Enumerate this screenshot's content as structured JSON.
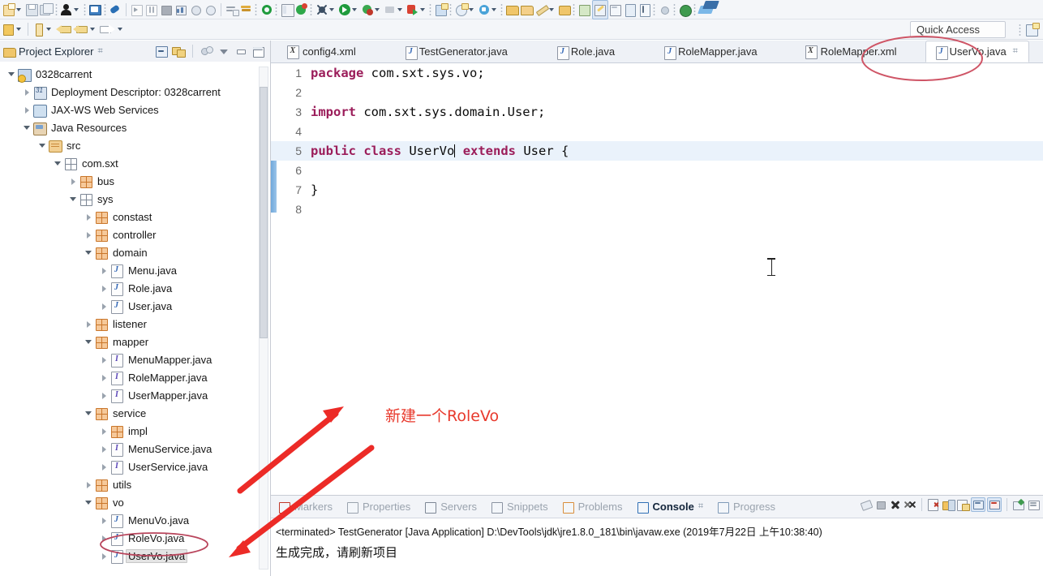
{
  "app": {
    "quick_access_label": "Quick Access"
  },
  "toolbar": {
    "row1_icons": [
      "new-wizard-icon",
      "save-icon",
      "save-all-icon",
      "user-account-icon",
      "print-icon",
      "link-icon",
      "run-last-icon",
      "debug-step-icon",
      "terminate-icon",
      "profile-icon",
      "coverage-icon",
      "run-ant-icon",
      "search-icon",
      "open-type-icon",
      "refresh-icon",
      "validate-icon",
      "new-java-project-icon",
      "run-icon",
      "debug-icon",
      "external-tools-icon",
      "server-icon",
      "new-class-icon",
      "new-package-icon",
      "open-task-icon",
      "git-icon",
      "database-icon",
      "report-icon",
      "maven-icon",
      "pin-icon"
    ],
    "row2_icons": [
      "new-wizard-icon",
      "new-annotation-icon",
      "back-icon",
      "forward-icon",
      "next-icon"
    ]
  },
  "explorer": {
    "title": "Project Explorer",
    "close_glyph": "⌗",
    "toolbar_icons": [
      "collapse-all-icon",
      "link-with-editor-icon",
      "view-filter-icon",
      "view-menu-icon",
      "minimize-icon",
      "maximize-icon"
    ],
    "tree": [
      {
        "label": "0328carrent",
        "depth": 0,
        "icon": "project-icon",
        "arrow": "expanded",
        "selected": false
      },
      {
        "label": "Deployment Descriptor: 0328carrent",
        "depth": 1,
        "icon": "deployment-icon",
        "arrow": "collapsed",
        "selected": false
      },
      {
        "label": "JAX-WS Web Services",
        "depth": 1,
        "icon": "web-services-icon",
        "arrow": "collapsed",
        "selected": false
      },
      {
        "label": "Java Resources",
        "depth": 1,
        "icon": "java-resources-icon",
        "arrow": "expanded",
        "selected": false
      },
      {
        "label": "src",
        "depth": 2,
        "icon": "source-folder-icon",
        "arrow": "expanded",
        "selected": false
      },
      {
        "label": "com.sxt",
        "depth": 3,
        "icon": "package-grey-icon",
        "arrow": "expanded",
        "selected": false
      },
      {
        "label": "bus",
        "depth": 4,
        "icon": "package-icon",
        "arrow": "collapsed",
        "selected": false
      },
      {
        "label": "sys",
        "depth": 4,
        "icon": "package-grey-icon",
        "arrow": "expanded",
        "selected": false
      },
      {
        "label": "constast",
        "depth": 5,
        "icon": "package-icon",
        "arrow": "collapsed",
        "selected": false
      },
      {
        "label": "controller",
        "depth": 5,
        "icon": "package-icon",
        "arrow": "collapsed",
        "selected": false
      },
      {
        "label": "domain",
        "depth": 5,
        "icon": "package-icon",
        "arrow": "expanded",
        "selected": false
      },
      {
        "label": "Menu.java",
        "depth": 6,
        "icon": "java-class-icon",
        "arrow": "collapsed",
        "selected": false
      },
      {
        "label": "Role.java",
        "depth": 6,
        "icon": "java-class-icon",
        "arrow": "collapsed",
        "selected": false
      },
      {
        "label": "User.java",
        "depth": 6,
        "icon": "java-class-icon",
        "arrow": "collapsed",
        "selected": false
      },
      {
        "label": "listener",
        "depth": 5,
        "icon": "package-icon",
        "arrow": "collapsed",
        "selected": false
      },
      {
        "label": "mapper",
        "depth": 5,
        "icon": "package-icon",
        "arrow": "expanded",
        "selected": false
      },
      {
        "label": "MenuMapper.java",
        "depth": 6,
        "icon": "java-interface-icon",
        "arrow": "collapsed",
        "selected": false
      },
      {
        "label": "RoleMapper.java",
        "depth": 6,
        "icon": "java-interface-icon",
        "arrow": "collapsed",
        "selected": false
      },
      {
        "label": "UserMapper.java",
        "depth": 6,
        "icon": "java-interface-icon",
        "arrow": "collapsed",
        "selected": false
      },
      {
        "label": "service",
        "depth": 5,
        "icon": "package-icon",
        "arrow": "expanded",
        "selected": false
      },
      {
        "label": "impl",
        "depth": 6,
        "icon": "package-icon",
        "arrow": "collapsed",
        "selected": false
      },
      {
        "label": "MenuService.java",
        "depth": 6,
        "icon": "java-interface-icon",
        "arrow": "collapsed",
        "selected": false
      },
      {
        "label": "UserService.java",
        "depth": 6,
        "icon": "java-interface-icon",
        "arrow": "collapsed",
        "selected": false
      },
      {
        "label": "utils",
        "depth": 5,
        "icon": "package-icon",
        "arrow": "collapsed",
        "selected": false
      },
      {
        "label": "vo",
        "depth": 5,
        "icon": "package-icon",
        "arrow": "expanded",
        "selected": false
      },
      {
        "label": "MenuVo.java",
        "depth": 6,
        "icon": "java-class-icon",
        "arrow": "collapsed",
        "selected": false
      },
      {
        "label": "RoleVo.java",
        "depth": 6,
        "icon": "java-class-icon",
        "arrow": "collapsed",
        "selected": false
      },
      {
        "label": "UserVo.java",
        "depth": 6,
        "icon": "java-class-icon",
        "arrow": "collapsed",
        "selected": true
      }
    ]
  },
  "editor": {
    "tabs": [
      {
        "label": "config4.xml",
        "icon": "xml-file-icon",
        "active": false,
        "closable": false
      },
      {
        "label": "TestGenerator.java",
        "icon": "java-file-icon",
        "active": false,
        "closable": false
      },
      {
        "label": "Role.java",
        "icon": "java-file-icon",
        "active": false,
        "closable": false
      },
      {
        "label": "RoleMapper.java",
        "icon": "java-file-icon",
        "active": false,
        "closable": false
      },
      {
        "label": "RoleMapper.xml",
        "icon": "xml-file-icon",
        "active": false,
        "closable": false
      },
      {
        "label": "UserVo.java",
        "icon": "java-file-icon",
        "active": true,
        "closable": true
      }
    ],
    "tab_close_glyph": "⌗",
    "lines": [
      {
        "n": "1",
        "current": false,
        "tokens": [
          {
            "t": "package",
            "c": "kw"
          },
          {
            "t": " com.sxt.sys.vo;",
            "c": "pl"
          }
        ]
      },
      {
        "n": "2",
        "current": false,
        "tokens": []
      },
      {
        "n": "3",
        "current": false,
        "tokens": [
          {
            "t": "import",
            "c": "kw"
          },
          {
            "t": " com.sxt.sys.domain.User;",
            "c": "pl"
          }
        ]
      },
      {
        "n": "4",
        "current": false,
        "tokens": []
      },
      {
        "n": "5",
        "current": true,
        "tokens": [
          {
            "t": "public",
            "c": "kw"
          },
          {
            "t": " ",
            "c": "pl"
          },
          {
            "t": "class",
            "c": "kw"
          },
          {
            "t": " UserVo",
            "c": "pl"
          },
          {
            "t": "|CARET|",
            "c": "caret"
          },
          {
            "t": " ",
            "c": "pl"
          },
          {
            "t": "extends",
            "c": "kw"
          },
          {
            "t": " User {",
            "c": "pl"
          }
        ]
      },
      {
        "n": "6",
        "current": false,
        "tokens": []
      },
      {
        "n": "7",
        "current": false,
        "tokens": [
          {
            "t": "}",
            "c": "pl"
          }
        ]
      },
      {
        "n": "8",
        "current": false,
        "tokens": []
      }
    ]
  },
  "console": {
    "tabs": [
      {
        "label": "Markers",
        "icon": "markers-icon",
        "active": false,
        "closable": false
      },
      {
        "label": "Properties",
        "icon": "properties-icon",
        "active": false,
        "closable": false
      },
      {
        "label": "Servers",
        "icon": "servers-icon",
        "active": false,
        "closable": false
      },
      {
        "label": "Snippets",
        "icon": "snippets-icon",
        "active": false,
        "closable": false
      },
      {
        "label": "Problems",
        "icon": "problems-icon",
        "active": false,
        "closable": false
      },
      {
        "label": "Console",
        "icon": "console-icon",
        "active": true,
        "closable": true
      },
      {
        "label": "Progress",
        "icon": "progress-icon",
        "active": false,
        "closable": false
      }
    ],
    "tab_close_glyph": "⌗",
    "toolbar_icons": [
      "relaunch-icon",
      "terminate-icon",
      "remove-launch-icon",
      "remove-all-launches-icon",
      "clear-console-icon",
      "scroll-lock-icon",
      "word-wrap-icon",
      "show-console-on-output-icon",
      "show-console-on-error-icon",
      "pin-console-icon",
      "display-selected-console-icon"
    ],
    "header_line": "<terminated> TestGenerator [Java Application] D:\\DevTools\\jdk\\jre1.8.0_181\\bin\\javaw.exe (2019年7月22日 上午10:38:40)",
    "output_line": "生成完成，请刷新项目"
  },
  "annotations": {
    "note_text": "新建一个RoleVo",
    "color": "#e8392c",
    "ellipse_tab_label": "UserVo.java",
    "ellipse_tree_label": "RoleVo.java"
  }
}
